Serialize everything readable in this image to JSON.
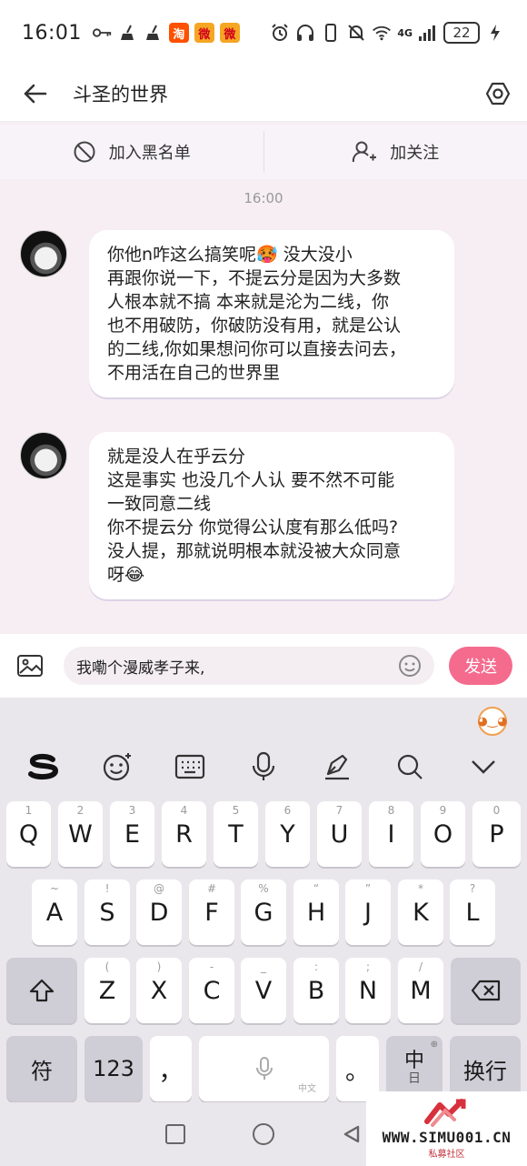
{
  "status_bar": {
    "time": "16:01",
    "network": "4G",
    "sim_label": "6",
    "battery": "22"
  },
  "header": {
    "title": "斗圣的世界"
  },
  "actions": {
    "block_label": "加入黑名单",
    "follow_label": "加关注"
  },
  "chat": {
    "timestamp": "16:00",
    "messages": [
      {
        "lines": [
          "你他n咋这么搞笑呢🥵 没大没小",
          "再跟你说一下，不提云分是因为大多数",
          "人根本就不搞 本来就是沦为二线，你",
          "也不用破防，你破防没有用，就是公认",
          "的二线,你如果想问你可以直接去问去，",
          "不用活在自己的世界里"
        ]
      },
      {
        "lines": [
          "就是没人在乎云分",
          "这是事实 也没几个人认 要不然不可能",
          "一致同意二线",
          "你不提云分 你觉得公认度有那么低吗?",
          "没人提，那就说明根本就没被大众同意",
          "呀😂"
        ]
      }
    ]
  },
  "input": {
    "value": "我嘞个漫威孝子来,",
    "send_label": "发送"
  },
  "keyboard": {
    "row1": [
      {
        "key": "Q",
        "sub": "1"
      },
      {
        "key": "W",
        "sub": "2"
      },
      {
        "key": "E",
        "sub": "3"
      },
      {
        "key": "R",
        "sub": "4"
      },
      {
        "key": "T",
        "sub": "5"
      },
      {
        "key": "Y",
        "sub": "6"
      },
      {
        "key": "U",
        "sub": "7"
      },
      {
        "key": "I",
        "sub": "8"
      },
      {
        "key": "O",
        "sub": "9"
      },
      {
        "key": "P",
        "sub": "0"
      }
    ],
    "row2": [
      {
        "key": "A",
        "sub": "~"
      },
      {
        "key": "S",
        "sub": "!"
      },
      {
        "key": "D",
        "sub": "@"
      },
      {
        "key": "F",
        "sub": "#"
      },
      {
        "key": "G",
        "sub": "%"
      },
      {
        "key": "H",
        "sub": "“"
      },
      {
        "key": "J",
        "sub": "”"
      },
      {
        "key": "K",
        "sub": "*"
      },
      {
        "key": "L",
        "sub": "?"
      }
    ],
    "row3": [
      {
        "key": "Z",
        "sub": "("
      },
      {
        "key": "X",
        "sub": ")"
      },
      {
        "key": "C",
        "sub": "-"
      },
      {
        "key": "V",
        "sub": "_"
      },
      {
        "key": "B",
        "sub": ":"
      },
      {
        "key": "N",
        "sub": ";"
      },
      {
        "key": "M",
        "sub": "/"
      }
    ],
    "symbol_label": "符",
    "number_label": "123",
    "comma_label": "，",
    "space_sub": "中文",
    "period_label": "。",
    "lang_main": "中",
    "lang_sub": "日",
    "enter_label": "换行"
  },
  "watermark": {
    "url": "WWW.SIMU001.CN",
    "sub": "私募社区"
  },
  "colors": {
    "send_button": "#f46b8e",
    "chat_background": "#f6eef2",
    "keyboard_background": "#eae7ec"
  },
  "icons": [
    "back-arrow-icon",
    "settings-hexagon-icon",
    "block-icon",
    "add-user-icon",
    "image-icon",
    "emoji-icon",
    "sogou-logo-icon",
    "keyboard-icon",
    "microphone-icon",
    "pen-icon",
    "search-icon",
    "chevron-down-icon",
    "shift-icon",
    "backspace-icon"
  ]
}
